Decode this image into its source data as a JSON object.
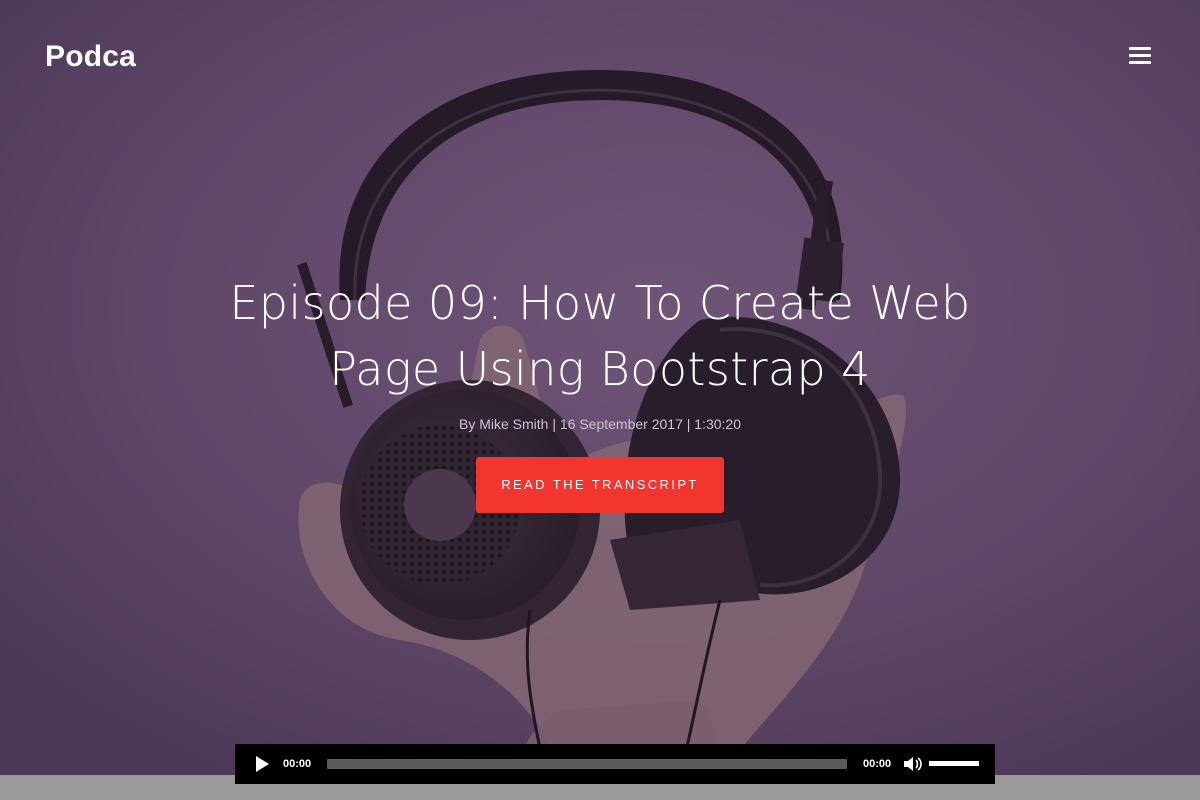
{
  "header": {
    "brand": "Podca",
    "menu_icon": "hamburger-menu-icon"
  },
  "hero": {
    "title": "Episode 09: How To Create Web Page Using Bootstrap 4",
    "meta": "By Mike Smith | 16 September 2017 | 1:30:20",
    "cta_label": "READ THE TRANSCRIPT",
    "background_image": "headphones held in hand on purple background"
  },
  "player": {
    "play_icon": "play-icon",
    "current_time": "00:00",
    "duration": "00:00",
    "progress_fraction": 0,
    "mute_icon": "volume-icon",
    "volume_fraction": 1.0
  },
  "colors": {
    "hero_tint": "#5f4868",
    "cta": "#f2352f",
    "player_bg": "#000000",
    "footer_bg": "#9a9a9a"
  }
}
